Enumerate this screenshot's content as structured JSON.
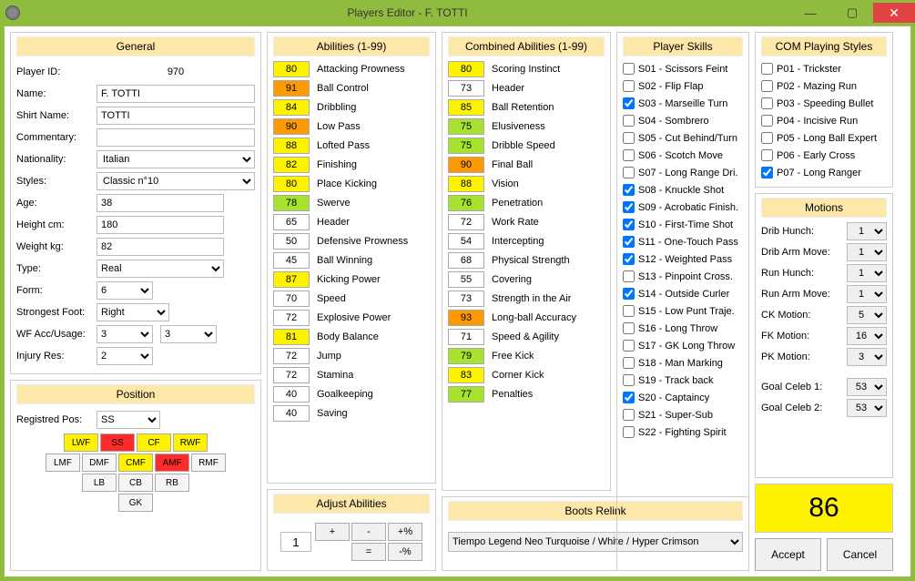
{
  "window": {
    "title": "Players Editor - F. TOTTI",
    "min": "—",
    "max": "▢",
    "close": "✕"
  },
  "general": {
    "title": "General",
    "labels": {
      "playerId": "Player ID:",
      "name": "Name:",
      "shirtName": "Shirt Name:",
      "commentary": "Commentary:",
      "nationality": "Nationality:",
      "styles": "Styles:",
      "age": "Age:",
      "height": "Height cm:",
      "weight": "Weight kg:",
      "type": "Type:",
      "form": "Form:",
      "foot": "Strongest Foot:",
      "wf": "WF Acc/Usage:",
      "injury": "Injury Res:"
    },
    "values": {
      "playerId": "970",
      "name": "F. TOTTI",
      "shirtName": "TOTTI",
      "commentary": "",
      "nationality": "Italian",
      "styles": "Classic n°10",
      "age": "38",
      "height": "180",
      "weight": "82",
      "type": "Real",
      "form": "6",
      "foot": "Right",
      "wfAcc": "3",
      "wfUsage": "3",
      "injury": "2"
    }
  },
  "position": {
    "title": "Position",
    "regLabel": "Registred Pos:",
    "regValue": "SS",
    "row1": [
      {
        "code": "LWF",
        "c": "yel"
      },
      {
        "code": "SS",
        "c": "red"
      },
      {
        "code": "CF",
        "c": "yel"
      },
      {
        "code": "RWF",
        "c": "yel"
      }
    ],
    "row2": [
      {
        "code": "LMF",
        "c": ""
      },
      {
        "code": "DMF",
        "c": ""
      },
      {
        "code": "CMF",
        "c": "yel"
      },
      {
        "code": "AMF",
        "c": "red"
      },
      {
        "code": "RMF",
        "c": ""
      }
    ],
    "row3": [
      {
        "code": "LB",
        "c": ""
      },
      {
        "code": "CB",
        "c": ""
      },
      {
        "code": "RB",
        "c": ""
      }
    ],
    "row4": [
      {
        "code": "GK",
        "c": ""
      }
    ]
  },
  "abilities": {
    "title": "Abilities (1-99)",
    "items": [
      {
        "v": 80,
        "n": "Attacking Prowness"
      },
      {
        "v": 91,
        "n": "Ball Control"
      },
      {
        "v": 84,
        "n": "Dribbling"
      },
      {
        "v": 90,
        "n": "Low Pass"
      },
      {
        "v": 88,
        "n": "Lofted Pass"
      },
      {
        "v": 82,
        "n": "Finishing"
      },
      {
        "v": 80,
        "n": "Place Kicking"
      },
      {
        "v": 78,
        "n": "Swerve"
      },
      {
        "v": 65,
        "n": "Header"
      },
      {
        "v": 50,
        "n": "Defensive Prowness"
      },
      {
        "v": 45,
        "n": "Ball Winning"
      },
      {
        "v": 87,
        "n": "Kicking Power"
      },
      {
        "v": 70,
        "n": "Speed"
      },
      {
        "v": 72,
        "n": "Explosive Power"
      },
      {
        "v": 81,
        "n": "Body Balance"
      },
      {
        "v": 72,
        "n": "Jump"
      },
      {
        "v": 72,
        "n": "Stamina"
      },
      {
        "v": 40,
        "n": "Goalkeeping"
      },
      {
        "v": 40,
        "n": "Saving"
      }
    ]
  },
  "combined": {
    "title": "Combined Abilities  (1-99)",
    "items": [
      {
        "v": 80,
        "n": "Scoring Instinct"
      },
      {
        "v": 73,
        "n": "Header"
      },
      {
        "v": 85,
        "n": "Ball Retention"
      },
      {
        "v": 75,
        "n": "Elusiveness"
      },
      {
        "v": 75,
        "n": "Dribble Speed"
      },
      {
        "v": 90,
        "n": "Final Ball"
      },
      {
        "v": 88,
        "n": "Vision"
      },
      {
        "v": 76,
        "n": "Penetration"
      },
      {
        "v": 72,
        "n": "Work Rate"
      },
      {
        "v": 54,
        "n": "Intercepting"
      },
      {
        "v": 68,
        "n": "Physical Strength"
      },
      {
        "v": 55,
        "n": "Covering"
      },
      {
        "v": 73,
        "n": "Strength in the Air"
      },
      {
        "v": 93,
        "n": "Long-ball Accuracy"
      },
      {
        "v": 71,
        "n": "Speed & Agility"
      },
      {
        "v": 79,
        "n": "Free Kick"
      },
      {
        "v": 83,
        "n": "Corner Kick"
      },
      {
        "v": 77,
        "n": "Penalties"
      }
    ]
  },
  "skills": {
    "title": "Player Skills",
    "items": [
      {
        "c": false,
        "n": "S01 - Scissors Feint"
      },
      {
        "c": false,
        "n": "S02 - Flip Flap"
      },
      {
        "c": true,
        "n": "S03 - Marseille Turn"
      },
      {
        "c": false,
        "n": "S04 - Sombrero"
      },
      {
        "c": false,
        "n": "S05 - Cut Behind/Turn"
      },
      {
        "c": false,
        "n": "S06 - Scotch Move"
      },
      {
        "c": false,
        "n": "S07 - Long Range Dri."
      },
      {
        "c": true,
        "n": "S08 - Knuckle Shot"
      },
      {
        "c": true,
        "n": "S09 - Acrobatic Finish."
      },
      {
        "c": true,
        "n": "S10 - First-Time Shot"
      },
      {
        "c": true,
        "n": "S11 - One-Touch Pass"
      },
      {
        "c": true,
        "n": "S12 - Weighted Pass"
      },
      {
        "c": false,
        "n": "S13 - Pinpoint Cross."
      },
      {
        "c": true,
        "n": "S14 - Outside Curler"
      },
      {
        "c": false,
        "n": "S15 - Low Punt Traje."
      },
      {
        "c": false,
        "n": "S16 - Long Throw"
      },
      {
        "c": false,
        "n": "S17 - GK Long Throw"
      },
      {
        "c": false,
        "n": "S18 - Man Marking"
      },
      {
        "c": false,
        "n": "S19 - Track back"
      },
      {
        "c": true,
        "n": "S20 - Captaincy"
      },
      {
        "c": false,
        "n": "S21 - Super-Sub"
      },
      {
        "c": false,
        "n": "S22 - Fighting Spirit"
      }
    ]
  },
  "com": {
    "title": "COM Playing Styles",
    "items": [
      {
        "c": false,
        "n": "P01 - Trickster"
      },
      {
        "c": false,
        "n": "P02 - Mazing Run"
      },
      {
        "c": false,
        "n": "P03 - Speeding Bullet"
      },
      {
        "c": false,
        "n": "P04 - Incisive Run"
      },
      {
        "c": false,
        "n": "P05 - Long Ball Expert"
      },
      {
        "c": false,
        "n": "P06 - Early Cross"
      },
      {
        "c": true,
        "n": "P07 - Long Ranger"
      }
    ]
  },
  "motions": {
    "title": "Motions",
    "rows": [
      {
        "l": "Drib Hunch:",
        "v": "1"
      },
      {
        "l": "Drib Arm Move:",
        "v": "1"
      },
      {
        "l": "Run Hunch:",
        "v": "1"
      },
      {
        "l": "Run Arm Move:",
        "v": "1"
      },
      {
        "l": "CK Motion:",
        "v": "5"
      },
      {
        "l": "FK Motion:",
        "v": "16"
      },
      {
        "l": "PK Motion:",
        "v": "3"
      }
    ],
    "celebs": [
      {
        "l": "Goal Celeb 1:",
        "v": "53"
      },
      {
        "l": "Goal Celeb 2:",
        "v": "53"
      }
    ]
  },
  "adjust": {
    "title": "Adjust Abilities",
    "step": "1",
    "btns": {
      "plus": "+",
      "minus": "-",
      "pluspct": "+%",
      "eq": "=",
      "minuspct": "-%"
    }
  },
  "boots": {
    "title": "Boots Relink",
    "value": "Tiempo Legend Neo Turquoise / White / Hyper Crimson"
  },
  "overall": "86",
  "buttons": {
    "accept": "Accept",
    "cancel": "Cancel"
  }
}
